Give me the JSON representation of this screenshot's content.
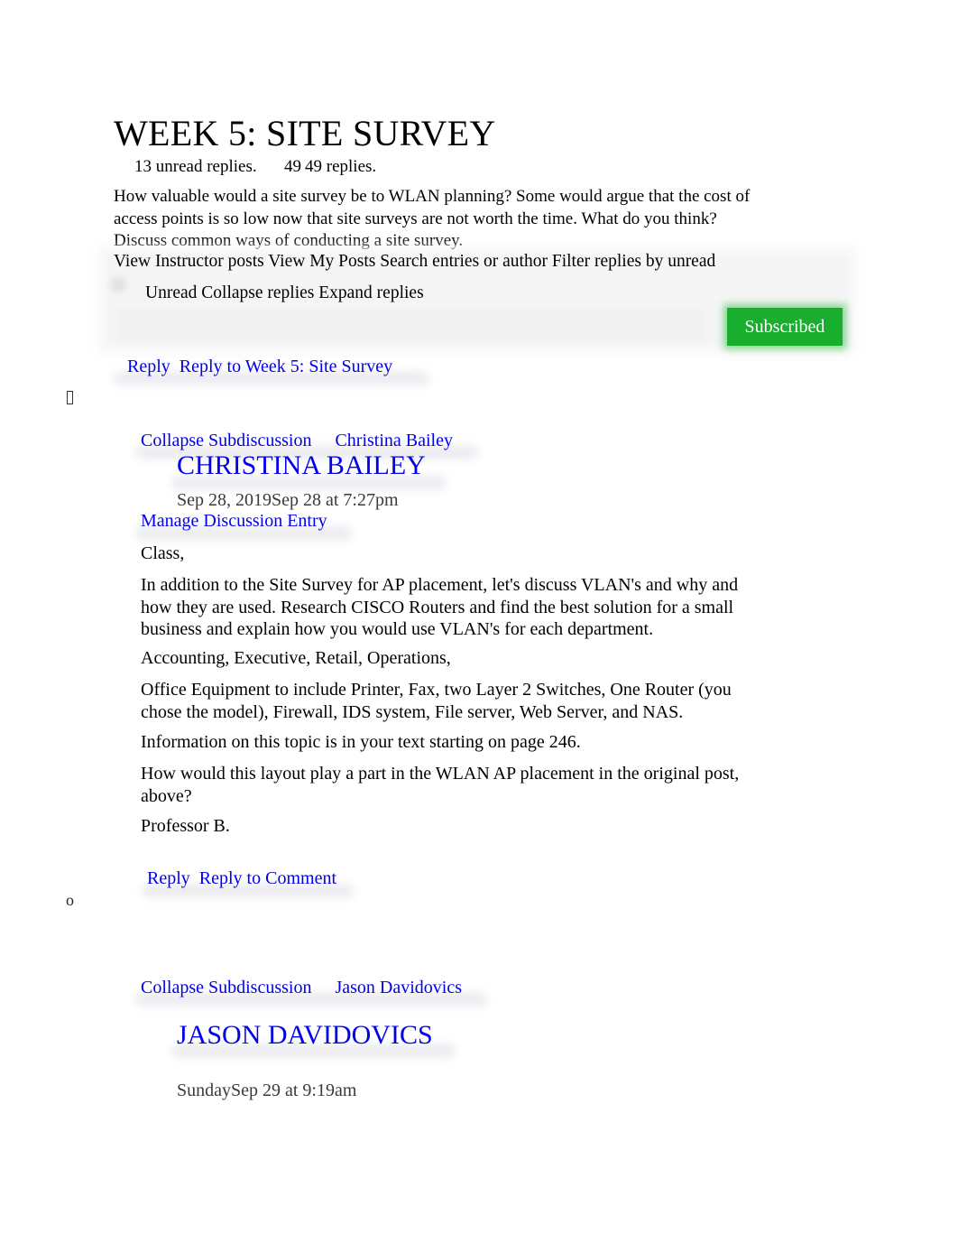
{
  "discussion": {
    "title": "WEEK 5: SITE SURVEY",
    "unread_count_label": "13 unread replies.",
    "reply_count_hidden": "49",
    "reply_count_label": "49 replies.",
    "prompt": "How valuable would a site survey be to WLAN planning? Some would argue that the cost of access points is so low now that site surveys are not worth the time. What do you think? Discuss common ways of conducting a site survey."
  },
  "toolbar": {
    "view_instructor_posts": "View Instructor posts",
    "view_my_posts": "View My Posts",
    "search_label": "Search entries or author",
    "filter_label": "Filter replies by unread",
    "unread": "Unread",
    "collapse_replies": "Collapse replies",
    "expand_replies": "Expand replies",
    "subscribed": "Subscribed",
    "subscribed_color": "#1aae2e"
  },
  "main_reply": {
    "reply": "Reply",
    "reply_to": "Reply to Week 5: Site Survey"
  },
  "entries": [
    {
      "bullet": "",
      "collapse": "Collapse Subdiscussion",
      "author_link": "Christina Bailey",
      "author_heading": "CHRISTINA BAILEY",
      "date": "Sep 28, 2019Sep 28 at 7:27pm",
      "manage": "Manage Discussion Entry",
      "paragraphs": [
        "Class,",
        "In addition to the Site Survey for AP placement, let's discuss VLAN's and why and how they are used. Research CISCO Routers and find the best solution for a small business and explain how you would use VLAN's for each department.",
        "Accounting, Executive, Retail, Operations,",
        "Office Equipment to include Printer, Fax, two Layer 2 Switches, One Router (you chose the model), Firewall, IDS system, File server, Web Server, and NAS.",
        "Information on this topic is in your text starting on page 246.",
        "How would this layout play a part in the WLAN AP placement in the original post, above?",
        "Professor B."
      ],
      "reply": "Reply",
      "reply_to": "Reply to Comment"
    },
    {
      "bullet": "o",
      "collapse": "Collapse Subdiscussion",
      "author_link": "Jason Davidovics",
      "author_heading": "JASON DAVIDOVICS",
      "date": "SundaySep 29 at 9:19am"
    }
  ]
}
